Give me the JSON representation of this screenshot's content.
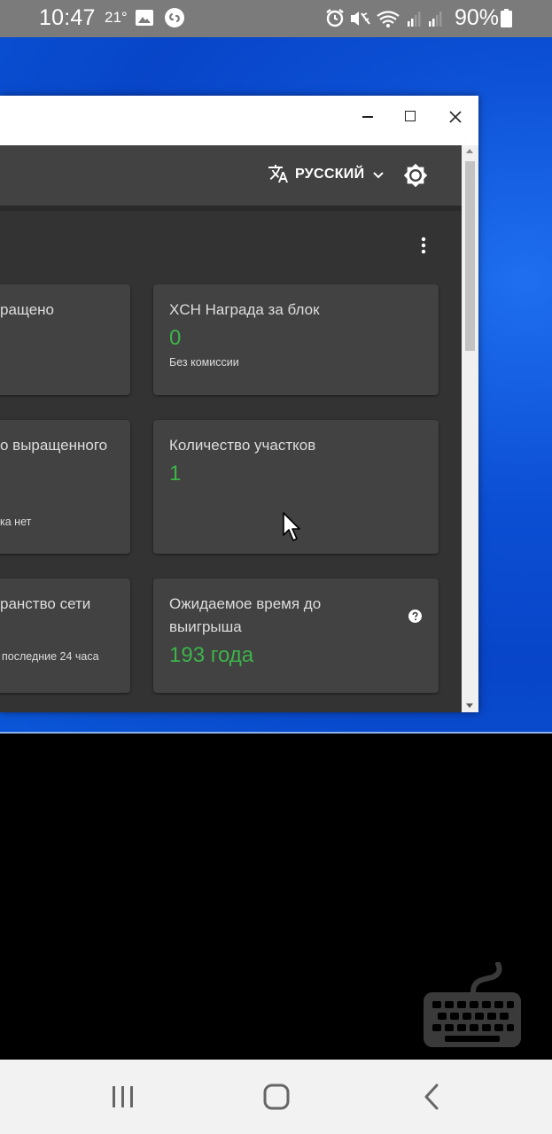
{
  "status_bar": {
    "time": "10:47",
    "temperature": "21°",
    "battery_percent": "90%",
    "icons": [
      "gallery-icon",
      "shazam-icon",
      "alarm-icon",
      "mute-icon",
      "wifi-icon",
      "signal-icon",
      "signal-icon",
      "battery-icon"
    ]
  },
  "window": {
    "controls": {
      "minimize": "minimize-icon",
      "maximize": "maximize-icon",
      "close": "close-icon"
    }
  },
  "header": {
    "language_label": "РУССКИЙ",
    "language_icon": "translate-icon",
    "settings_icon": "gear-icon"
  },
  "cards": [
    {
      "title": "ращено",
      "value": "",
      "subtitle": ""
    },
    {
      "title": "XCH Награда за блок",
      "value": "0",
      "subtitle": "Без комиссии"
    },
    {
      "title": "о выращенного",
      "value": "",
      "subtitle": "ка нет"
    },
    {
      "title": "Количество участков",
      "value": "1",
      "subtitle": ""
    },
    {
      "title": "ранство сети",
      "value": "",
      "subtitle": "последние 24 часа"
    },
    {
      "title_line1": "Ожидаемое время до",
      "title_line2": "выигрыша",
      "value": "193 года",
      "subtitle": "",
      "help_icon": "help-icon"
    }
  ],
  "colors": {
    "accent_green": "#3cb44a",
    "header_bg": "#424242",
    "card_bg": "#424242",
    "content_bg": "#333333",
    "desktop_blue": "#0c4fd4"
  }
}
